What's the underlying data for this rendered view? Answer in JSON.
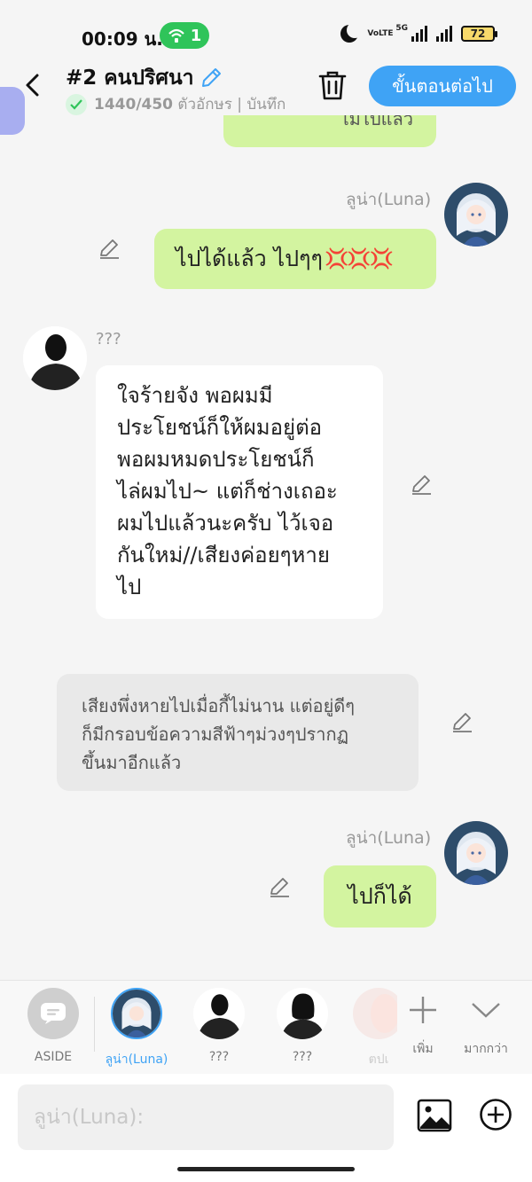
{
  "status_bar": {
    "time": "00:09 น.",
    "hotspot_count": "1",
    "volte_label": "VoLTE",
    "net_label": "5G",
    "battery": "72"
  },
  "header": {
    "title": "#2 คนปริศนา",
    "char_count": "1440/450",
    "sub_text": "ตัวอักษร | บันทึก",
    "next_button": "ขั้นตอนต่อไป"
  },
  "messages": {
    "partial_text": "ไม่ไปแล้ว",
    "msg1": {
      "name": "ลูน่า(Luna)",
      "text": "ไปได้แล้ว ไปๆๆ",
      "emoji": "💢💢💢"
    },
    "msg2": {
      "name": "???",
      "lines": [
        "ใจร้ายจัง พอผมมี",
        "ประโยชน์ก็ให้ผมอยู่ต่อ",
        "พอผมหมดประโยชน์ก็",
        "ไล่ผมไป~ แต่ก็ช่างเถอะ",
        "ผมไปแล้วนะครับ ไว้เจอ",
        "กันใหม่//เสียงค่อยๆหาย",
        "ไป"
      ]
    },
    "aside": {
      "lines": [
        "เสียงพึ่งหายไปเมื่อกี้ไม่นาน แต่อยู่ดีๆ",
        "ก็มีกรอบข้อความสีฟ้าๆม่วงๆปรากฏ",
        "ขึ้นมาอีกแล้ว"
      ]
    },
    "msg3": {
      "name": "ลูน่า(Luna)",
      "text": "ไปก็ได้"
    }
  },
  "character_bar": {
    "aside_label": "ASIDE",
    "luna_label": "ลูน่า(Luna)",
    "unknown1_label": "???",
    "unknown2_label": "???",
    "partial_label": "ตปเ",
    "add_label": "เพิ่ม",
    "more_label": "มากกว่า"
  },
  "input": {
    "placeholder": "ลูน่า(Luna):"
  },
  "colors": {
    "accent_blue": "#3fa3f5",
    "user_bubble": "#d3f4a0",
    "other_bubble": "#ffffff",
    "aside_bubble": "#e9e9e9",
    "hotspot_green": "#2fc45a"
  }
}
